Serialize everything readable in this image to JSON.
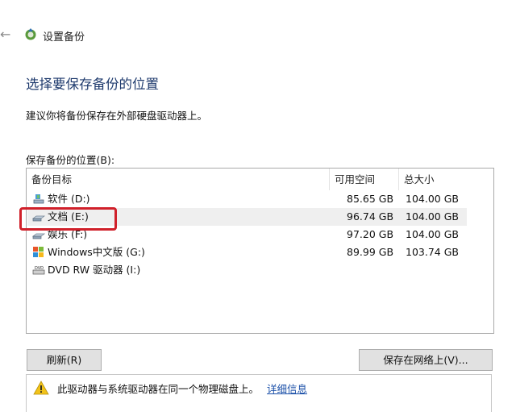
{
  "window": {
    "title": "设置备份"
  },
  "page": {
    "heading": "选择要保存备份的位置",
    "subtitle": "建议你将备份保存在外部硬盘驱动器上。",
    "list_label": "保存备份的位置(B):"
  },
  "table": {
    "columns": [
      "备份目标",
      "可用空间",
      "总大小"
    ],
    "rows": [
      {
        "name": "软件 (D:)",
        "free": "85.65 GB",
        "total": "104.00 GB",
        "icon": "drive-icon-shared",
        "selected": false
      },
      {
        "name": "文档 (E:)",
        "free": "96.74 GB",
        "total": "104.00 GB",
        "icon": "drive-icon",
        "selected": true
      },
      {
        "name": "娱乐 (F:)",
        "free": "97.20 GB",
        "total": "104.00 GB",
        "icon": "drive-icon",
        "selected": false
      },
      {
        "name": "Windows中文版 (G:)",
        "free": "89.99 GB",
        "total": "103.74 GB",
        "icon": "windows-drive-icon",
        "selected": false
      },
      {
        "name": "DVD RW 驱动器 (I:)",
        "free": "",
        "total": "",
        "icon": "dvd-drive-icon",
        "selected": false
      }
    ]
  },
  "buttons": {
    "refresh": "刷新(R)",
    "save_network": "保存在网络上(V)..."
  },
  "warning": {
    "text": "此驱动器与系统驱动器在同一个物理磁盘上。",
    "link": "详细信息",
    "icon": "warning-icon"
  },
  "colors": {
    "heading": "#1e3a6d",
    "highlight": "#d0202a",
    "link": "#1a4fa8"
  }
}
